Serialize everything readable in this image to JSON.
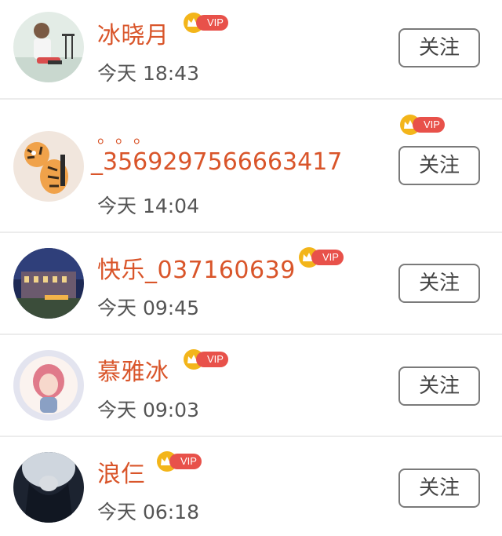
{
  "users": [
    {
      "name": "冰晓月",
      "time": "今天 18:43",
      "vip": "VIP",
      "follow": "关注"
    },
    {
      "name_top": "。。。",
      "name": "_3569297566663417",
      "time": "今天 14:04",
      "vip": "VIP",
      "follow": "关注"
    },
    {
      "name": "快乐_037160639",
      "time": "今天 09:45",
      "vip": "VIP",
      "follow": "关注"
    },
    {
      "name": "慕雅冰",
      "time": "今天 09:03",
      "vip": "VIP",
      "follow": "关注"
    },
    {
      "name": "浪仨",
      "time": "今天 06:18",
      "vip": "VIP",
      "follow": "关注"
    }
  ],
  "colors": {
    "name": "#d9552a",
    "vip_pill": "#e8514a",
    "vip_crown": "#f3b51a",
    "divider": "#ececec"
  }
}
